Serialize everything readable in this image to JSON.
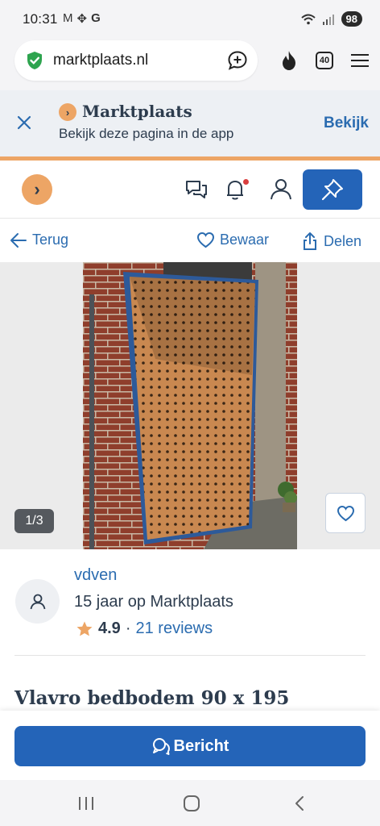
{
  "status_bar": {
    "time": "10:31",
    "notification_icons": [
      "mail-icon",
      "pinwheel-icon",
      "google-icon"
    ],
    "notification_glyphs": [
      "M",
      "✥",
      "G"
    ],
    "battery": "98"
  },
  "browser": {
    "url": "marktplaats.nl",
    "tabs_count": "40"
  },
  "app_banner": {
    "title": "Marktplaats",
    "subtitle": "Bekijk deze pagina in de app",
    "action": "Bekijk"
  },
  "nav": {
    "back": "Terug",
    "save": "Bewaar",
    "share": "Delen"
  },
  "photo": {
    "counter": "1/3"
  },
  "seller": {
    "name": "vdven",
    "since": "15 jaar op Marktplaats",
    "rating": "4.9",
    "separator": "·",
    "reviews": "21 reviews"
  },
  "listing": {
    "title": "Vlavro bedbodem 90 x 195"
  },
  "cta": {
    "label": "Bericht"
  },
  "colors": {
    "brand_orange": "#eda565",
    "brand_blue": "#2464b8",
    "link_blue": "#2b6cb0",
    "navy": "#2d3c4e"
  }
}
